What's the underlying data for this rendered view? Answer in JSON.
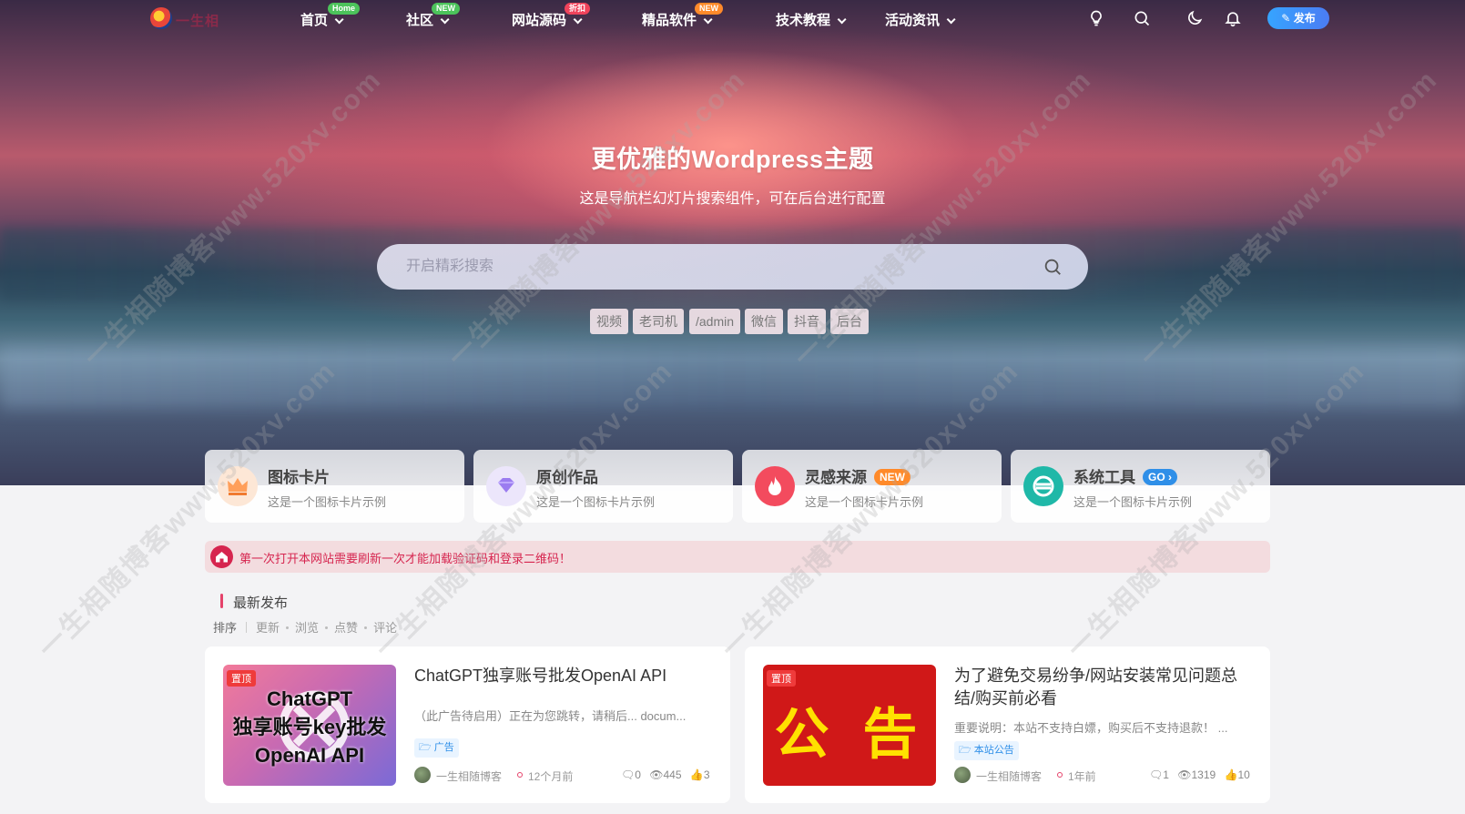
{
  "brand": {
    "logo_text": "一生相"
  },
  "nav": {
    "items": [
      {
        "label": "首页",
        "badge": "Home",
        "badge_color": "#4cc35b"
      },
      {
        "label": "社区",
        "badge": "NEW",
        "badge_color": "#4cc35b"
      },
      {
        "label": "网站源码",
        "badge": "折扣",
        "badge_color": "#f0435b"
      },
      {
        "label": "精品软件",
        "badge": "NEW",
        "badge_color": "#ff8a2a"
      },
      {
        "label": "技术教程",
        "badge": "",
        "badge_color": ""
      },
      {
        "label": "活动资讯",
        "badge": "",
        "badge_color": ""
      }
    ],
    "icons": [
      "lightbulb-icon",
      "search-icon",
      "moon-icon",
      "bell-icon"
    ],
    "publish_label": "发布"
  },
  "hero": {
    "title": "更优雅的Wordpress主题",
    "subtitle": "这是导航栏幻灯片搜索组件，可在后台进行配置",
    "search_placeholder": "开启精彩搜索",
    "tags": [
      "视频",
      "老司机",
      "/admin",
      "微信",
      "抖音",
      "后台"
    ]
  },
  "cards": [
    {
      "title": "图标卡片",
      "desc": "这是一个图标卡片示例",
      "pill": "",
      "icon": "crown-icon",
      "color": "#ff9f5a"
    },
    {
      "title": "原创作品",
      "desc": "这是一个图标卡片示例",
      "pill": "",
      "icon": "gem-icon",
      "color": "#9b7cf0"
    },
    {
      "title": "灵感来源",
      "desc": "这是一个图标卡片示例",
      "pill": "NEW",
      "icon": "fire-icon",
      "color": "#f34b5e"
    },
    {
      "title": "系统工具",
      "desc": "这是一个图标卡片示例",
      "pill": "GO",
      "icon": "tool-icon",
      "color": "#1fb8a8"
    }
  ],
  "notice": {
    "text": "第一次打开本网站需要刷新一次才能加载验证码和登录二维码！"
  },
  "section": {
    "title": "最新发布",
    "sort_label": "排序",
    "sort_options": [
      "更新",
      "浏览",
      "点赞",
      "评论"
    ]
  },
  "posts": [
    {
      "pin": "置顶",
      "thumb_lines": [
        "ChatGPT",
        "独享账号key批发",
        "OpenAI API"
      ],
      "title": "ChatGPT独享账号批发OpenAI API",
      "desc": "（此广告待启用）正在为您跳转，请稍后... docum...",
      "category": "广告",
      "author": "一生相随博客",
      "time": "12个月前",
      "comments": "0",
      "views": "445",
      "likes": "3"
    },
    {
      "pin": "置顶",
      "thumb_lines": [
        "公 告"
      ],
      "title": "为了避免交易纷争/网站安装常见问题总结/购买前必看",
      "desc": "重要说明：本站不支持白嫖，购买后不支持退款！ ...",
      "category": "本站公告",
      "author": "一生相随博客",
      "time": "1年前",
      "comments": "1",
      "views": "1319",
      "likes": "10"
    }
  ],
  "watermark": "一生相随博客www.520xv.com"
}
